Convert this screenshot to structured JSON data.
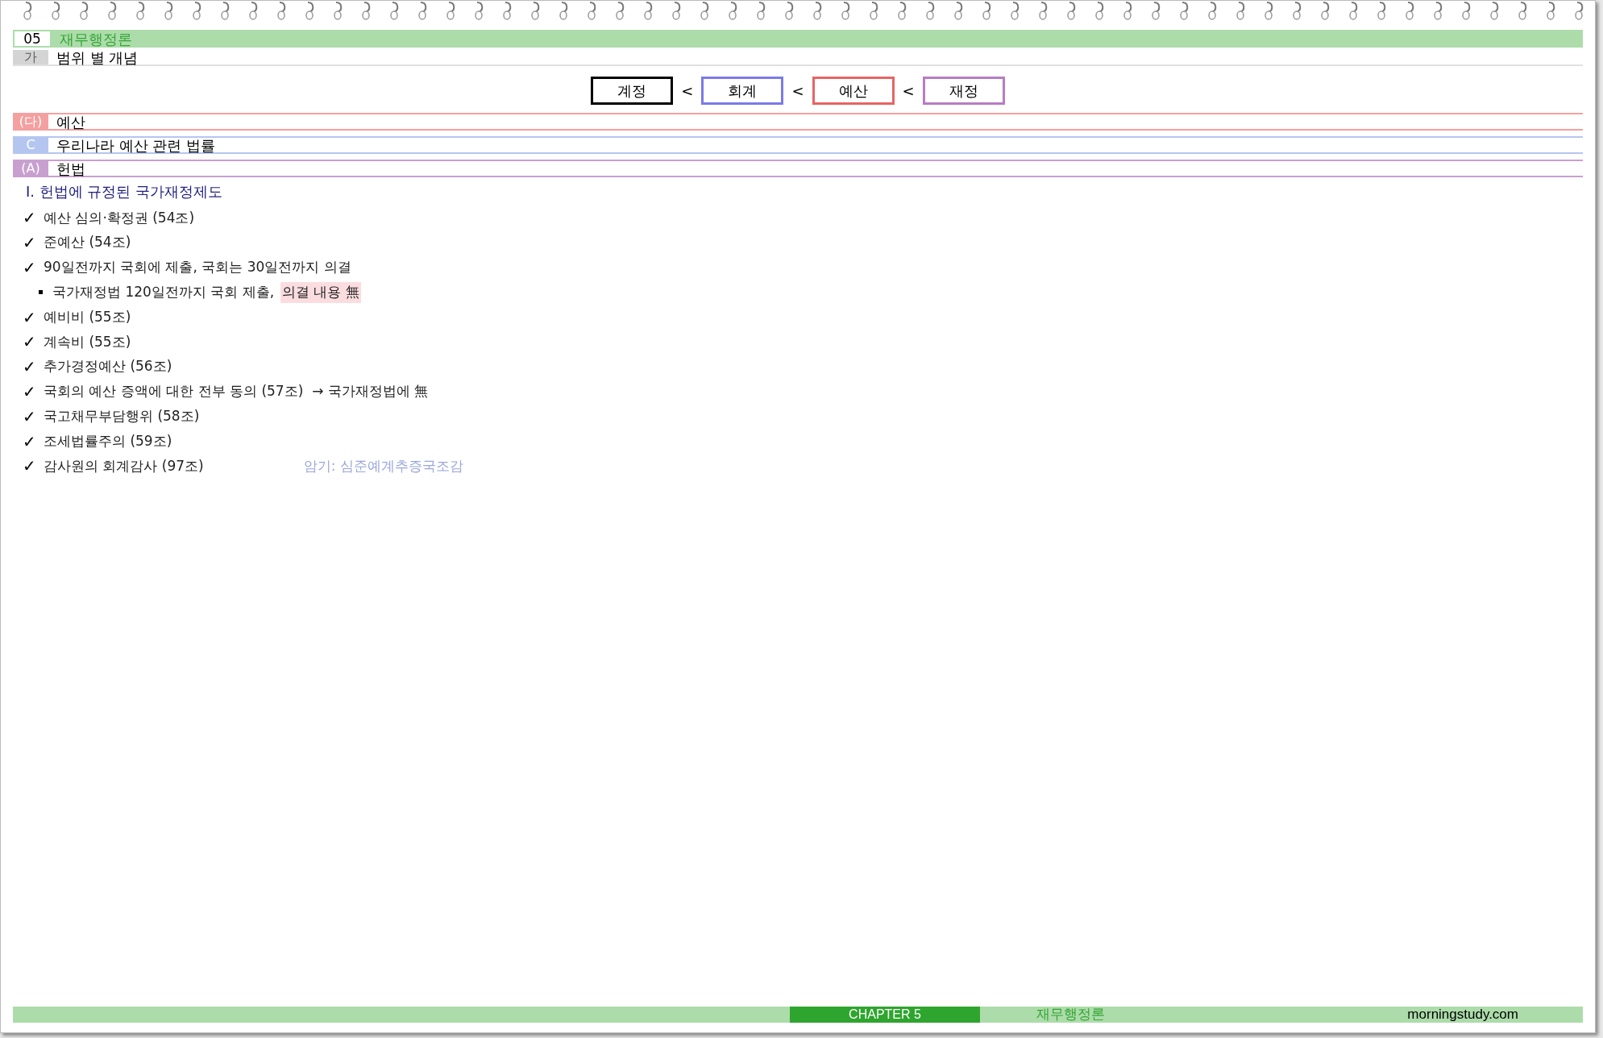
{
  "chapter": {
    "number": "05",
    "title": "재무행정론"
  },
  "topic": {
    "marker": "가",
    "title": "범위 별 개념"
  },
  "concepts": [
    {
      "label": "계정",
      "color": "#000000"
    },
    {
      "separator": "<",
      "label": "회계",
      "color": "#7b7be8"
    },
    {
      "separator": "<",
      "label": "예산",
      "color": "#e86464"
    },
    {
      "separator": "<",
      "label": "재정",
      "color": "#b87cc4"
    }
  ],
  "sections": [
    {
      "marker": "(다)",
      "title": "예산",
      "color": "#f4a0a0"
    },
    {
      "marker": "C",
      "title": "우리나라 예산 관련 법률",
      "color": "#b4c6f0"
    },
    {
      "marker": "(A)",
      "title": "헌법",
      "color": "#c8a0d0"
    }
  ],
  "heading": "Ⅰ. 헌법에 규정된 국가재정제도",
  "items": [
    {
      "kind": "check",
      "mark": "✓",
      "text": "예산 심의·확정권 (54조)"
    },
    {
      "kind": "check",
      "mark": "✓",
      "text": "준예산 (54조)"
    },
    {
      "kind": "check",
      "mark": "✓",
      "text": "90일전까지 국회에 제출, 국회는 30일전까지 의결"
    },
    {
      "kind": "bullet",
      "text": "국가재정법 120일전까지 국회 제출,",
      "highlight": "의결 내용 無"
    },
    {
      "kind": "check",
      "mark": "✓",
      "text": "예비비 (55조)"
    },
    {
      "kind": "check",
      "mark": "✓",
      "text": "계속비 (55조)"
    },
    {
      "kind": "check",
      "mark": "✓",
      "text": "추가경정예산 (56조)"
    },
    {
      "kind": "check",
      "mark": "✓",
      "text": "국회의 예산 증액에 대한 전부 동의 (57조)  → 국가재정법에 無"
    },
    {
      "kind": "check",
      "mark": "✓",
      "text": "국고채무부담행위 (58조)"
    },
    {
      "kind": "check",
      "mark": "✓",
      "text": "조세법률주의 (59조)"
    },
    {
      "kind": "check",
      "mark": "✓",
      "text": "감사원의 회계감사 (97조)",
      "note": "암기: 심준예계추증국조감"
    }
  ],
  "footer": {
    "chapter": "CHAPTER 5",
    "subject": "재무행정론",
    "site": "morningstudy.com"
  }
}
